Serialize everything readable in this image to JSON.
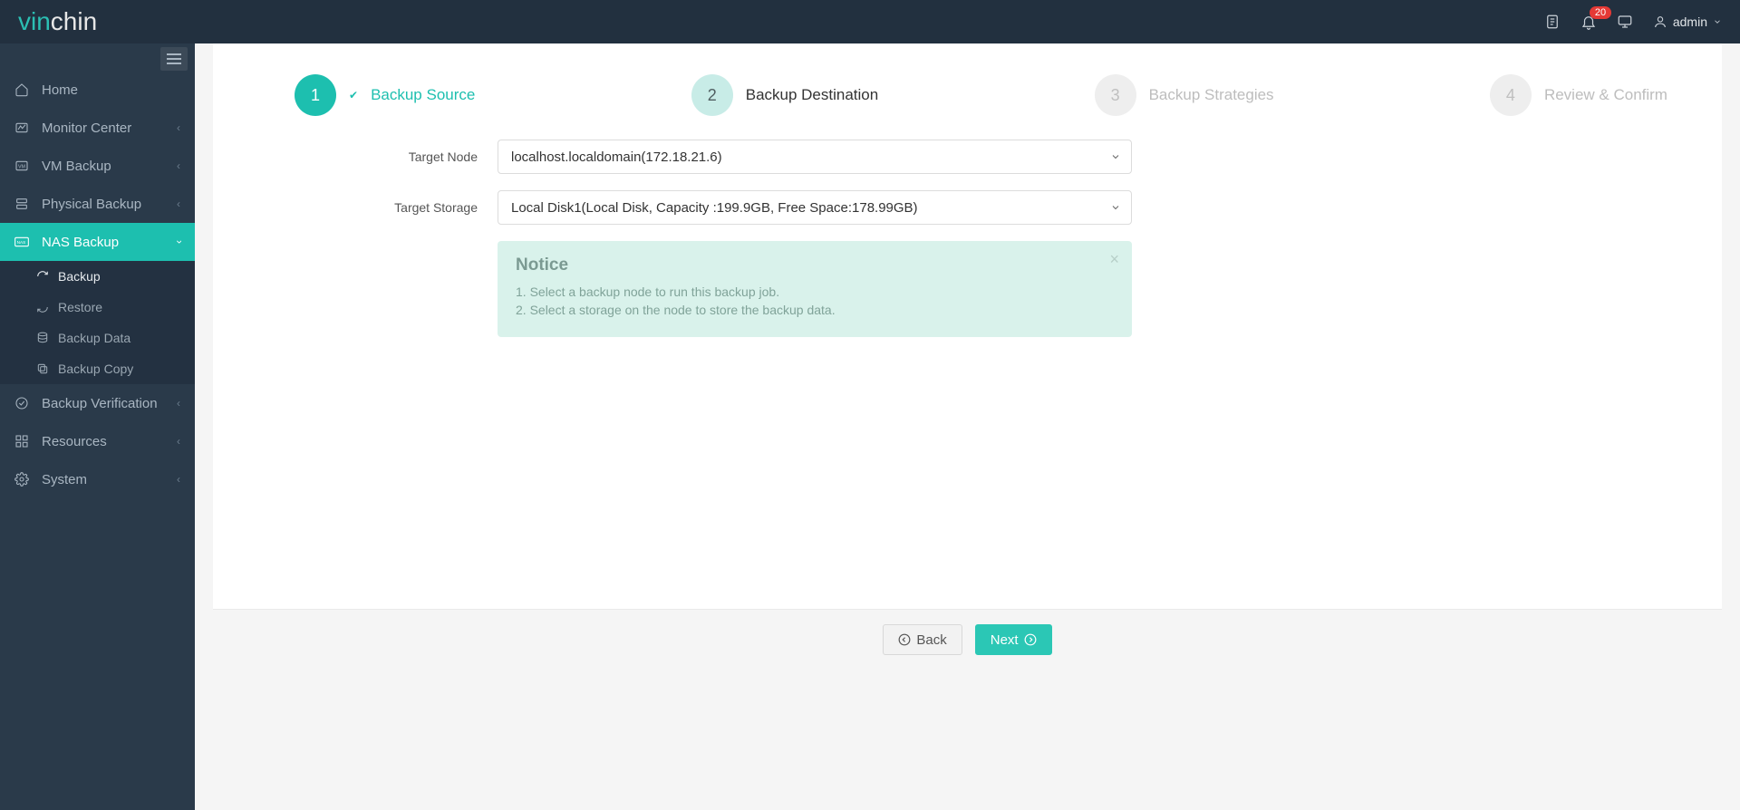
{
  "logo": {
    "part1": "vin",
    "part2": "chin"
  },
  "topbar": {
    "notification_count": "20",
    "user": "admin"
  },
  "sidebar": {
    "items": [
      {
        "icon": "home",
        "label": "Home",
        "expandable": false
      },
      {
        "icon": "monitor",
        "label": "Monitor Center",
        "expandable": true
      },
      {
        "icon": "vm",
        "label": "VM Backup",
        "expandable": true
      },
      {
        "icon": "physical",
        "label": "Physical Backup",
        "expandable": true
      },
      {
        "icon": "nas",
        "label": "NAS Backup",
        "expandable": true,
        "active": true
      },
      {
        "icon": "verify",
        "label": "Backup Verification",
        "expandable": true
      },
      {
        "icon": "resources",
        "label": "Resources",
        "expandable": true
      },
      {
        "icon": "system",
        "label": "System",
        "expandable": true
      }
    ],
    "nas_sub": [
      {
        "icon": "cycle",
        "label": "Backup",
        "selected": true
      },
      {
        "icon": "undo",
        "label": "Restore"
      },
      {
        "icon": "db",
        "label": "Backup Data"
      },
      {
        "icon": "copy",
        "label": "Backup Copy"
      }
    ]
  },
  "wizard": {
    "steps": [
      {
        "num": "1",
        "label": "Backup Source",
        "state": "done"
      },
      {
        "num": "2",
        "label": "Backup Destination",
        "state": "current"
      },
      {
        "num": "3",
        "label": "Backup Strategies",
        "state": "pending"
      },
      {
        "num": "4",
        "label": "Review & Confirm",
        "state": "pending"
      }
    ]
  },
  "form": {
    "target_node_label": "Target Node",
    "target_node_value": "localhost.localdomain(172.18.21.6)",
    "target_storage_label": "Target Storage",
    "target_storage_value": "Local Disk1(Local Disk, Capacity :199.9GB, Free Space:178.99GB)"
  },
  "notice": {
    "title": "Notice",
    "line1": "1. Select a backup node to run this backup job.",
    "line2": "2. Select a storage on the node to store the backup data."
  },
  "buttons": {
    "back": "Back",
    "next": "Next"
  }
}
